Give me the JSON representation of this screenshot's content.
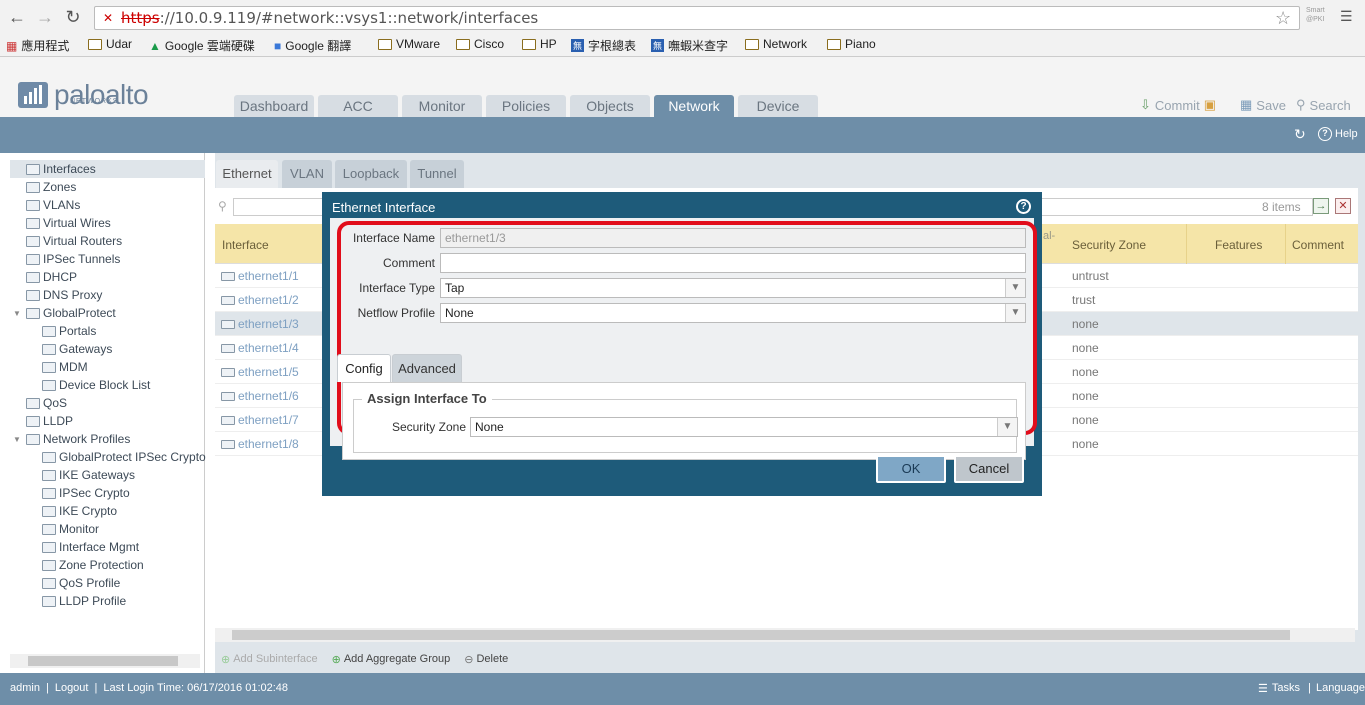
{
  "browser": {
    "url_https": "https",
    "url_rest": "://10.0.9.119/#network::vsys1::network/interfaces",
    "bookmarks": [
      "應用程式",
      "Udar",
      "Google 雲端硬碟",
      "Google 翻譯",
      "VMware",
      "Cisco",
      "HP",
      "字根總表",
      "嘸蝦米查字",
      "Network",
      "Piano"
    ],
    "smart_label": "Smart @PKI"
  },
  "header": {
    "logo_text": "paloalto",
    "logo_sub": "NETWORKS",
    "tabs": [
      "Dashboard",
      "ACC",
      "Monitor",
      "Policies",
      "Objects",
      "Network",
      "Device"
    ],
    "active_tab": "Network",
    "commit": "Commit",
    "save": "Save",
    "search": "Search",
    "help": "Help"
  },
  "sidebar": {
    "items": [
      "Interfaces",
      "Zones",
      "VLANs",
      "Virtual Wires",
      "Virtual Routers",
      "IPSec Tunnels",
      "DHCP",
      "DNS Proxy",
      "GlobalProtect",
      "Portals",
      "Gateways",
      "MDM",
      "Device Block List",
      "QoS",
      "LLDP",
      "Network Profiles",
      "GlobalProtect IPSec Crypto",
      "IKE Gateways",
      "IPSec Crypto",
      "IKE Crypto",
      "Monitor",
      "Interface Mgmt",
      "Zone Protection",
      "QoS Profile",
      "LLDP Profile"
    ]
  },
  "subtabs": [
    "Ethernet",
    "VLAN",
    "Loopback",
    "Tunnel"
  ],
  "grid": {
    "items_count": "8 items",
    "columns": {
      "interface": "Interface",
      "security_zone": "Security Zone",
      "features": "Features",
      "comment": "Comment",
      "partial": "al-"
    },
    "rows": [
      {
        "interface": "ethernet1/1",
        "zone": "untrust"
      },
      {
        "interface": "ethernet1/2",
        "zone": "trust"
      },
      {
        "interface": "ethernet1/3",
        "zone": "none"
      },
      {
        "interface": "ethernet1/4",
        "zone": "none"
      },
      {
        "interface": "ethernet1/5",
        "zone": "none"
      },
      {
        "interface": "ethernet1/6",
        "zone": "none"
      },
      {
        "interface": "ethernet1/7",
        "zone": "none"
      },
      {
        "interface": "ethernet1/8",
        "zone": "none"
      }
    ]
  },
  "actions": {
    "add_sub": "Add Subinterface",
    "add_agg": "Add Aggregate Group",
    "delete": "Delete"
  },
  "footer": {
    "user": "admin",
    "logout": "Logout",
    "last_login": "Last Login Time: 06/17/2016 01:02:48",
    "tasks": "Tasks",
    "language": "Language"
  },
  "modal": {
    "title": "Ethernet Interface",
    "interface_name_label": "Interface Name",
    "interface_name_value": "ethernet1/3",
    "comment_label": "Comment",
    "comment_value": "",
    "interface_type_label": "Interface Type",
    "interface_type_value": "Tap",
    "netflow_label": "Netflow Profile",
    "netflow_value": "None",
    "tab_config": "Config",
    "tab_advanced": "Advanced",
    "assign_legend": "Assign Interface To",
    "security_zone_label": "Security Zone",
    "security_zone_value": "None",
    "ok": "OK",
    "cancel": "Cancel"
  },
  "colors": {
    "accent": "#6e8ea8",
    "modal": "#1e5b7a",
    "highlight": "#e10d1b",
    "grid_header": "#f5e5a8"
  }
}
